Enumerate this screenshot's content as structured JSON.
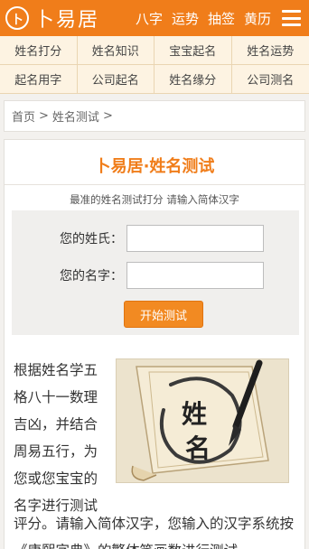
{
  "header": {
    "logo_mark": "卜",
    "logo_text": "卜易居",
    "nav": [
      "八字",
      "运势",
      "抽签",
      "黄历"
    ],
    "menu_icon": "hamburger-icon"
  },
  "menu": [
    "姓名打分",
    "姓名知识",
    "宝宝起名",
    "姓名运势",
    "起名用字",
    "公司起名",
    "姓名缘分",
    "公司测名"
  ],
  "breadcrumb": {
    "home": "首页",
    "separator": ">",
    "current": "姓名测试"
  },
  "card": {
    "title": "卜易居·姓名测试",
    "subtitle": "最准的姓名测试打分 请输入简体汉字",
    "surname_label": "您的姓氏：",
    "surname_value": "",
    "given_label": "您的名字：",
    "given_value": "",
    "submit_label": "开始测试",
    "description_narrow": "根据姓名学五格八十一数理吉凶，并结合周易五行，为您或您宝宝的名字进行测试",
    "description_wide": "评分。请输入简体汉字，您输入的汉字系统按《康熙字典》的繁体笔画数进行测试",
    "illustration_text": "姓名"
  },
  "colors": {
    "brand_orange": "#f07d1a",
    "menu_bg": "#fdf3e2",
    "button": "#f28a22"
  }
}
